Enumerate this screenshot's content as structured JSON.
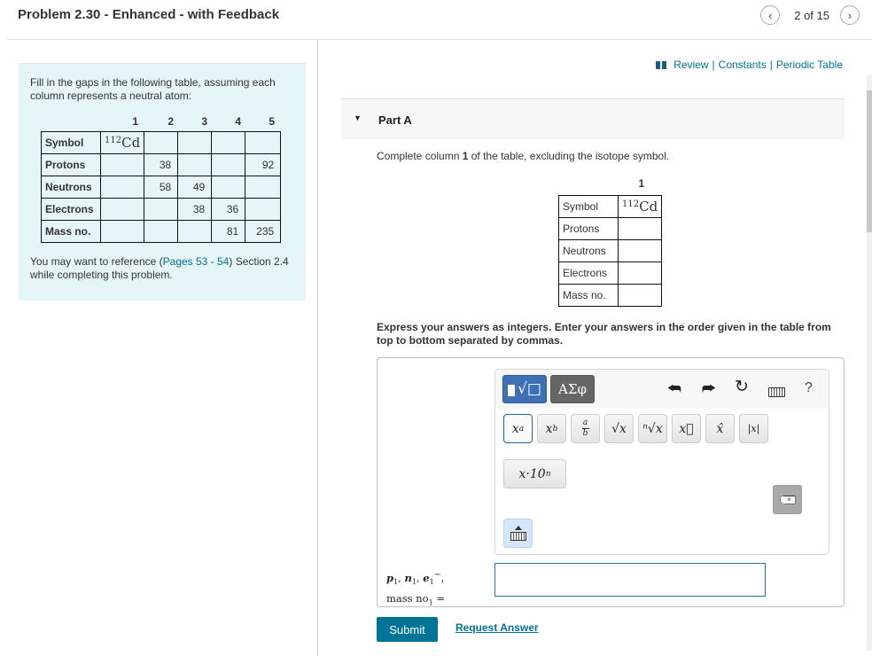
{
  "header": {
    "title": "Problem 2.30 - Enhanced - with Feedback",
    "pagination": {
      "current": 2,
      "total": 15,
      "label": "2 of 15",
      "prev_icon": "chevron-left-icon",
      "next_icon": "chevron-right-icon"
    }
  },
  "left_panel": {
    "intro": "Fill in the gaps in the following table, assuming each column represents a neutral atom:",
    "table": {
      "column_headers": [
        "1",
        "2",
        "3",
        "4",
        "5"
      ],
      "rows": [
        {
          "label": "Symbol",
          "cells": [
            "",
            "",
            "",
            "",
            ""
          ],
          "isotope": {
            "mass": "112",
            "element": "Cd"
          }
        },
        {
          "label": "Protons",
          "cells": [
            "",
            "38",
            "",
            "",
            "92"
          ]
        },
        {
          "label": "Neutrons",
          "cells": [
            "",
            "58",
            "49",
            "",
            ""
          ]
        },
        {
          "label": "Electrons",
          "cells": [
            "",
            "",
            "38",
            "36",
            ""
          ]
        },
        {
          "label": "Mass no.",
          "cells": [
            "",
            "",
            "",
            "81",
            "235"
          ]
        }
      ]
    },
    "reference": {
      "prefix": "You may want to reference (",
      "link": "Pages 53 - 54",
      "suffix": ") Section 2.4 while completing this problem."
    }
  },
  "resources": {
    "icon": "book-icon",
    "links": [
      "Review",
      "Constants",
      "Periodic Table"
    ],
    "separator": "|"
  },
  "part": {
    "toggle_icon": "triangle-down-icon",
    "title": "Part A",
    "instruction_prefix": "Complete column ",
    "instruction_bold": "1",
    "instruction_suffix": " of the table, excluding the isotope symbol.",
    "table": {
      "column_header": "1",
      "rows": [
        {
          "label": "Symbol",
          "isotope": {
            "mass": "112",
            "element": "Cd"
          }
        },
        {
          "label": "Protons",
          "value": ""
        },
        {
          "label": "Neutrons",
          "value": ""
        },
        {
          "label": "Electrons",
          "value": ""
        },
        {
          "label": "Mass no.",
          "value": ""
        }
      ]
    },
    "express": "Express your answers as integers. Enter your answers in the order given in the table from top to bottom separated by commas."
  },
  "math_editor": {
    "modes": [
      {
        "name": "templates",
        "icon": "templates-icon",
        "active": true
      },
      {
        "name": "greek",
        "label": "ΑΣφ",
        "active": false
      }
    ],
    "tools": [
      {
        "name": "undo",
        "icon": "undo-icon",
        "glyph": "↰"
      },
      {
        "name": "redo",
        "icon": "redo-icon",
        "glyph": "↱"
      },
      {
        "name": "reset",
        "icon": "reset-icon",
        "glyph": "↻"
      },
      {
        "name": "keyboard",
        "icon": "keyboard-icon"
      },
      {
        "name": "help",
        "icon": "help-icon",
        "glyph": "?"
      }
    ],
    "templates": [
      {
        "name": "superscript",
        "label": "xᵃ"
      },
      {
        "name": "subscript",
        "label": "x_b"
      },
      {
        "name": "fraction",
        "num": "a",
        "den": "b"
      },
      {
        "name": "square-root",
        "label": "√x"
      },
      {
        "name": "nth-root",
        "label": "ⁿ√x"
      },
      {
        "name": "vector",
        "label": "x⃗"
      },
      {
        "name": "unit-vector",
        "label": "x̂"
      },
      {
        "name": "absolute-value",
        "label": "|x|"
      }
    ],
    "scientific": {
      "base": "x·10",
      "exp": "n"
    },
    "backspace_icon": "backspace-icon",
    "keyboard_toggle_icon": "keyboard-toggle-icon"
  },
  "answer": {
    "label_line1": [
      "p",
      "n",
      "e"
    ],
    "label_sub": "1",
    "label_line2": "mass no",
    "equals": "=",
    "value": ""
  },
  "actions": {
    "submit": "Submit",
    "request_answer": "Request Answer"
  }
}
